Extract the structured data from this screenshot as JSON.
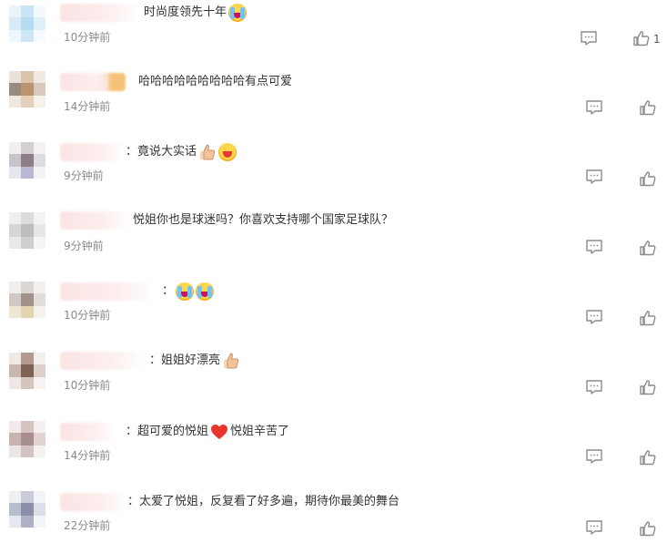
{
  "comments": [
    {
      "text": "时尚度领先十年",
      "emojis": [
        "cry-face"
      ],
      "time": "10分钟前",
      "likes": "1",
      "avatar": [
        "#eaf4fa",
        "#c9e4f4",
        "#f4f9fc",
        "#d7ecf8",
        "#b6dcf2",
        "#e0f0f9",
        "#eef7fc",
        "#cfe7f5",
        "#f6fbfd"
      ]
    },
    {
      "text": "哈哈哈哈哈哈哈哈哈有点可爱",
      "emojis": [],
      "time": "14分钟前",
      "avatar": [
        "#e9e2da",
        "#d9c4ad",
        "#f2e9e0",
        "#9a8b80",
        "#b8956f",
        "#d7c9bb",
        "#efe8e1",
        "#e4d0ba",
        "#f6f1eb"
      ]
    },
    {
      "text": "：竟说大实话",
      "emojis": [
        "thumbs-up",
        "laugh-face"
      ],
      "time": "9分钟前",
      "avatar": [
        "#f1eeee",
        "#d6cfd0",
        "#f4f1f2",
        "#c9c3cc",
        "#8d7f88",
        "#dedbe2",
        "#e6e6ef",
        "#b8b8d0",
        "#f3f3f7"
      ]
    },
    {
      "text": "悦姐你也是球迷吗？你喜欢支持哪个国家足球队？",
      "emojis": [],
      "time": "9分钟前",
      "avatar": [
        "#efefef",
        "#dcdcdc",
        "#f3f3f3",
        "#d6d6d6",
        "#bdbdbd",
        "#e6e6e6",
        "#e9e9e9",
        "#cfcfcf",
        "#f5f5f5"
      ]
    },
    {
      "text": "：",
      "emojis": [
        "cry-face",
        "cry-face"
      ],
      "time": "10分钟前",
      "avatar": [
        "#f1efee",
        "#dcd6d2",
        "#f3f1f0",
        "#cfc8c4",
        "#9e928b",
        "#e2ddd9",
        "#efe7d6",
        "#e3d4b2",
        "#f5f2ec"
      ]
    },
    {
      "text": "：姐姐好漂亮",
      "emojis": [
        "thumbs-up"
      ],
      "time": "10分钟前",
      "avatar": [
        "#efe9e6",
        "#b29a8e",
        "#f3efed",
        "#c8b7ad",
        "#7f6256",
        "#ddd0c9",
        "#ede8e5",
        "#d4c6be",
        "#f6f3f1"
      ]
    },
    {
      "text": "：超可爱的悦姐",
      "emojis": [
        "heart"
      ],
      "text2": "悦姐辛苦了",
      "time": "14分钟前",
      "avatar": [
        "#f2eaea",
        "#d6c3c2",
        "#f5efef",
        "#c9b3b1",
        "#a88f8d",
        "#e2d3d2",
        "#ece6e6",
        "#d1c4c3",
        "#f6f2f2"
      ]
    },
    {
      "text": "：太爱了悦姐，反复看了好多遍，期待你最美的舞台",
      "emojis": [],
      "time": "22分钟前",
      "avatar": [
        "#eef0f4",
        "#c9ccd8",
        "#f3f4f7",
        "#b9bdd0",
        "#8b8fa8",
        "#dcdfe8",
        "#e7e8ef",
        "#aeb1c6",
        "#f4f5f8"
      ]
    }
  ],
  "icons": {
    "reply": "comment-reply-icon",
    "like": "thumbs-up-outline-icon"
  },
  "colors": {
    "time": "#8a8a8a",
    "icon": "#8c8c8c",
    "text": "#333333"
  }
}
